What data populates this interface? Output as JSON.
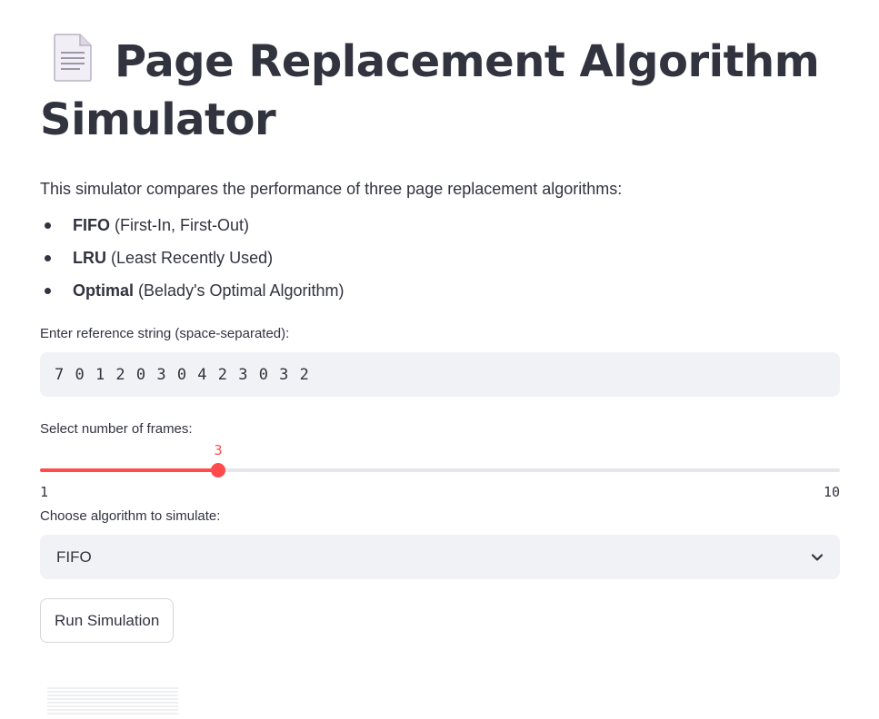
{
  "header": {
    "icon": "document-icon",
    "title": "Page Replacement Algorithm Simulator"
  },
  "intro": {
    "text": "This simulator compares the performance of three page replacement algorithms:"
  },
  "algorithms": [
    {
      "name": "FIFO",
      "description": "(First-In, First-Out)"
    },
    {
      "name": "LRU",
      "description": "(Least Recently Used)"
    },
    {
      "name": "Optimal",
      "description": "(Belady's Optimal Algorithm)"
    }
  ],
  "reference_input": {
    "label": "Enter reference string (space-separated):",
    "value": "7 0 1 2 0 3 0 4 2 3 0 3 2"
  },
  "frames_slider": {
    "label": "Select number of frames:",
    "value": 3,
    "min": 1,
    "max": 10,
    "accent_color": "#ff4b4b"
  },
  "algorithm_select": {
    "label": "Choose algorithm to simulate:",
    "selected": "FIFO",
    "icon": "chevron-down-icon"
  },
  "run_button": {
    "label": "Run Simulation"
  }
}
